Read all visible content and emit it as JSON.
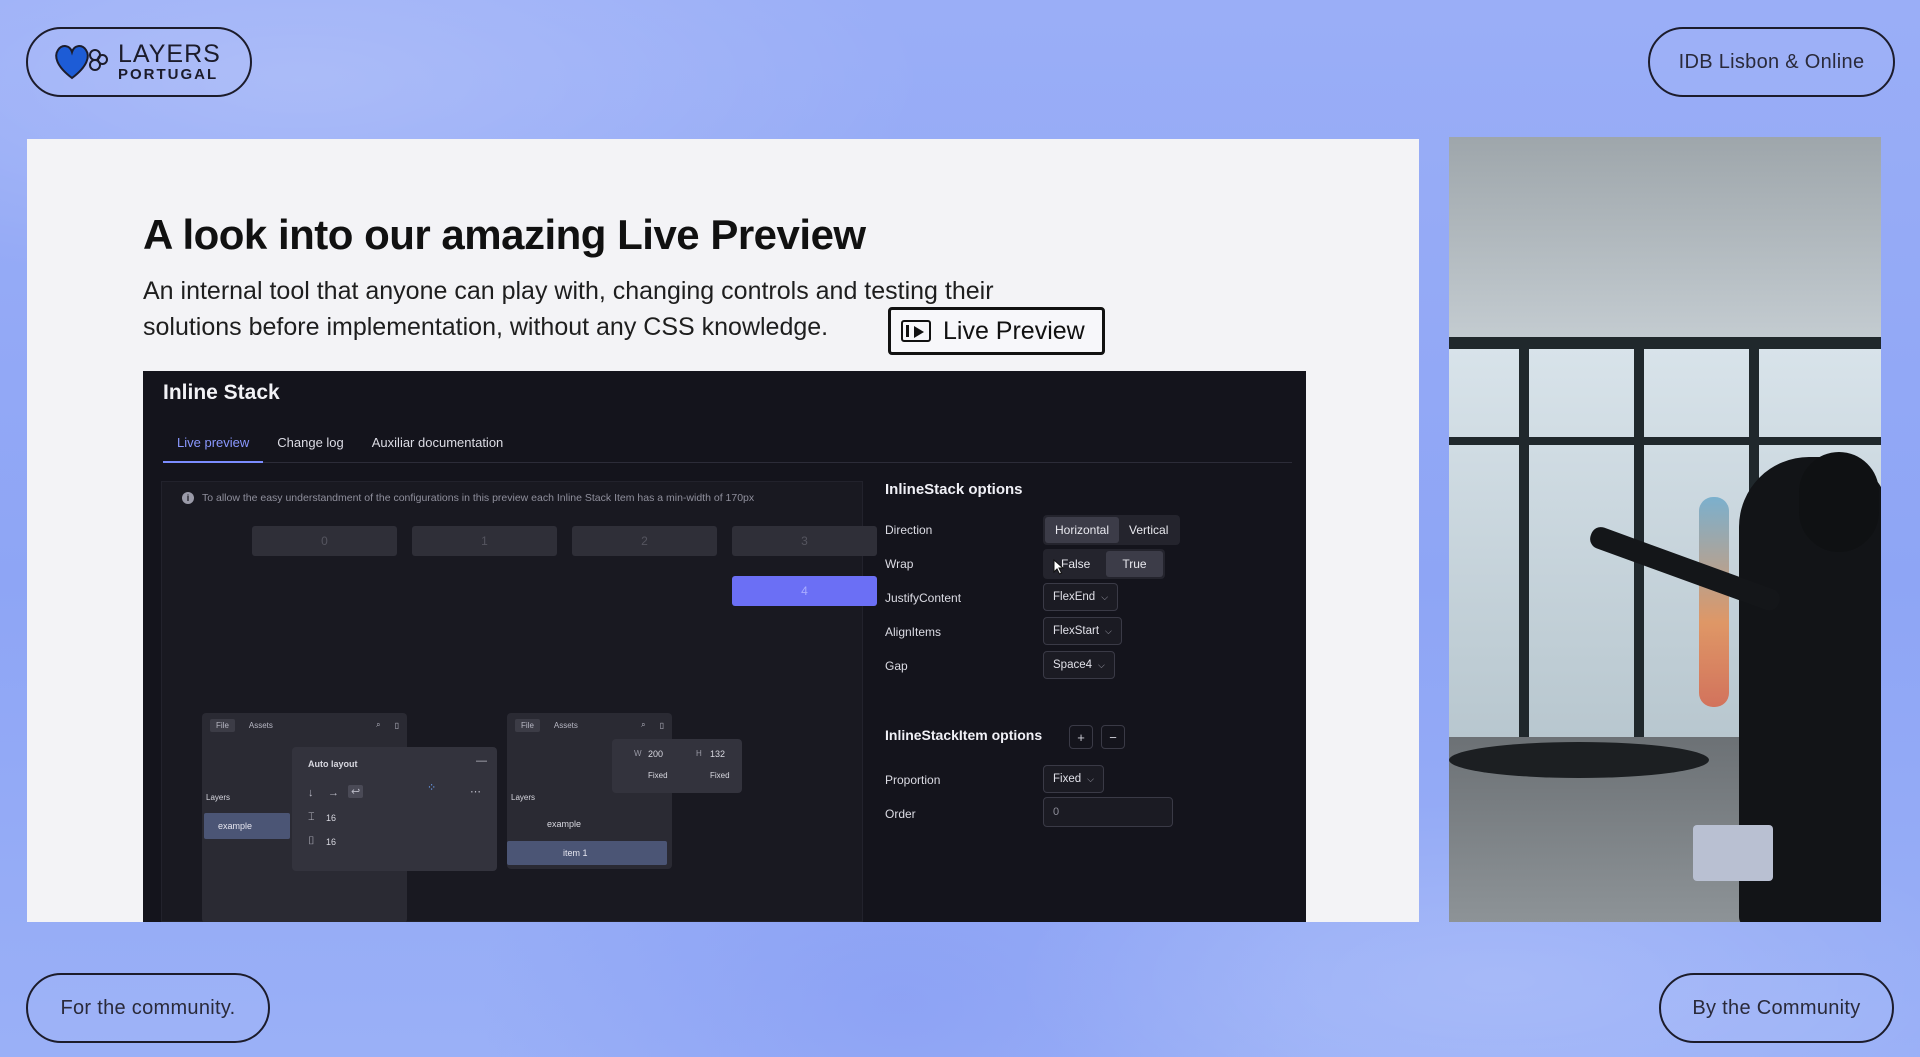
{
  "event": {
    "logo_line1": "LAYERS",
    "logo_line2": "PORTUGAL",
    "venue": "IDB Lisbon & Online",
    "tagline_left": "For the community.",
    "tagline_right": "By the Community"
  },
  "slide": {
    "title": "A look into our amazing Live Preview",
    "subtitle": "An internal tool that anyone can play with, changing controls and testing their solutions before implementation, without any CSS knowledge.",
    "live_preview_button": "Live Preview"
  },
  "tool": {
    "title": "Inline Stack",
    "tabs": [
      {
        "label": "Live preview",
        "active": true
      },
      {
        "label": "Change log",
        "active": false
      },
      {
        "label": "Auxiliar documentation",
        "active": false
      }
    ],
    "info_text": "To allow the easy understandment of the configurations in this preview each Inline Stack Item has a min-width of 170px",
    "stack_items": [
      "0",
      "1",
      "2",
      "3",
      "4"
    ],
    "mini_left": {
      "tab_file": "File",
      "tab_assets": "Assets",
      "layers_label": "Layers",
      "selected_layer": "example",
      "panel_title": "Auto layout",
      "spacing_1": "16",
      "spacing_2": "16"
    },
    "mini_right": {
      "tab_file": "File",
      "tab_assets": "Assets",
      "layers_label": "Layers",
      "layer": "example",
      "selected_layer": "item 1",
      "w_label": "W",
      "w_value": "200",
      "h_label": "H",
      "h_value": "132",
      "w_mode": "Fixed",
      "h_mode": "Fixed"
    },
    "options": {
      "heading": "InlineStack options",
      "direction_label": "Direction",
      "direction_options": [
        "Horizontal",
        "Vertical"
      ],
      "direction_selected": "Horizontal",
      "wrap_label": "Wrap",
      "wrap_options": [
        "False",
        "True"
      ],
      "wrap_selected": "True",
      "justify_label": "JustifyContent",
      "justify_value": "FlexEnd",
      "align_label": "AlignItems",
      "align_value": "FlexStart",
      "gap_label": "Gap",
      "gap_value": "Space4",
      "item_heading": "InlineStackItem options",
      "add_symbol": "+",
      "remove_symbol": "−",
      "proportion_label": "Proportion",
      "proportion_value": "Fixed",
      "order_label": "Order",
      "order_value": "0"
    }
  },
  "colors": {
    "background": "#93a9f6",
    "accent": "#6b6ff5",
    "tab_active": "#8a98ff",
    "logo_heart": "#1d5cd6"
  },
  "icons": [
    "heart-logo-icon",
    "play-screen-icon",
    "info-icon",
    "search-icon",
    "book-icon",
    "chevron-down-icon",
    "cursor-icon"
  ]
}
